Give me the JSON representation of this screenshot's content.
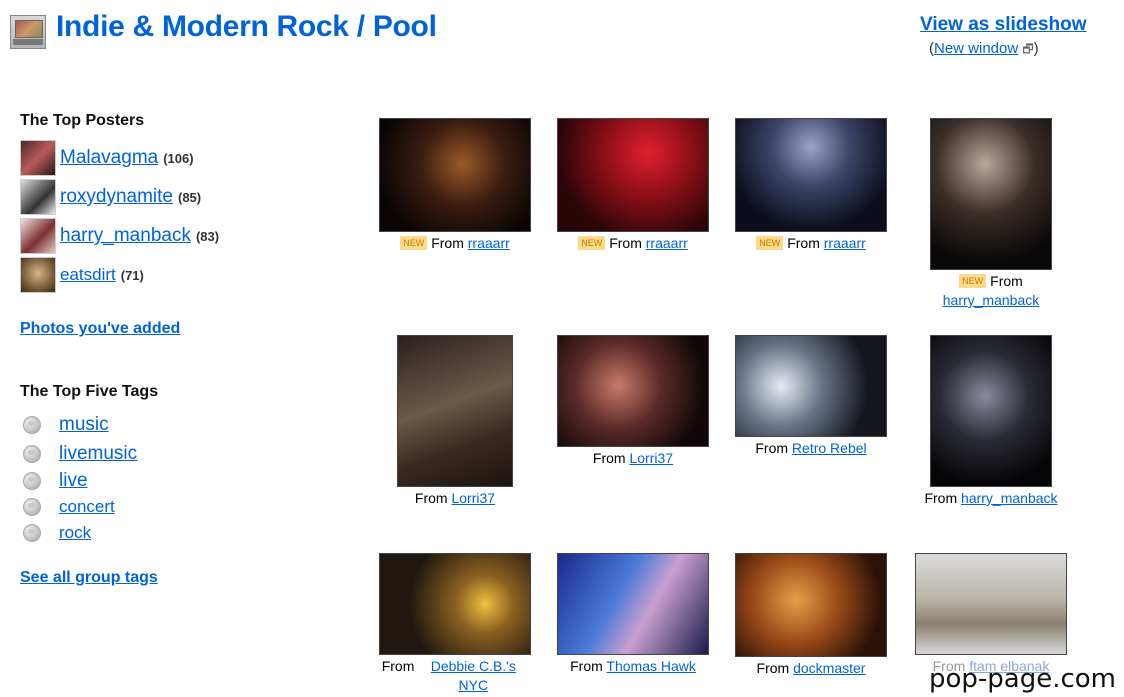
{
  "header": {
    "group_name": "Indie & Modern Rock",
    "separator": "/",
    "section": "Pool",
    "slideshow_label": "View as slideshow",
    "new_window_label": "New window"
  },
  "sidebar": {
    "top_posters_heading": "The Top Posters",
    "posters": [
      {
        "name": "Malavagma",
        "count": "(106)"
      },
      {
        "name": "roxydynamite",
        "count": "(85)"
      },
      {
        "name": "harry_manback",
        "count": "(83)"
      },
      {
        "name": "eatsdirt",
        "count": "(71)"
      }
    ],
    "photos_added_label": "Photos you've added",
    "top_tags_heading": "The Top Five Tags",
    "tags": [
      "music",
      "livemusic",
      "live",
      "concert",
      "rock"
    ],
    "all_tags_label": "See all group tags"
  },
  "photos": [
    {
      "new_badge": "NEW",
      "from_label": "From",
      "author": "rraaarr"
    },
    {
      "new_badge": "NEW",
      "from_label": "From",
      "author": "rraaarr"
    },
    {
      "new_badge": "NEW",
      "from_label": "From",
      "author": "rraaarr"
    },
    {
      "new_badge": "NEW",
      "from_label": "From",
      "author": "harry_manback"
    },
    {
      "from_label": "From",
      "author": "Lorri37"
    },
    {
      "from_label": "From",
      "author": "Lorri37"
    },
    {
      "from_label": "From",
      "author": "Retro Rebel"
    },
    {
      "from_label": "From",
      "author": "harry_manback"
    },
    {
      "from_label": "From",
      "author": "Debbie C.B.'s NYC"
    },
    {
      "from_label": "From",
      "author": "Thomas Hawk"
    },
    {
      "from_label": "From",
      "author": "dockmaster"
    },
    {
      "from_label": "From",
      "author": "ftam elbanak"
    }
  ],
  "watermark": "pop-page.com",
  "colors": {
    "link": "#0063dc",
    "new_badge_bg": "#fdd98a",
    "new_badge_text": "#c27c00"
  }
}
